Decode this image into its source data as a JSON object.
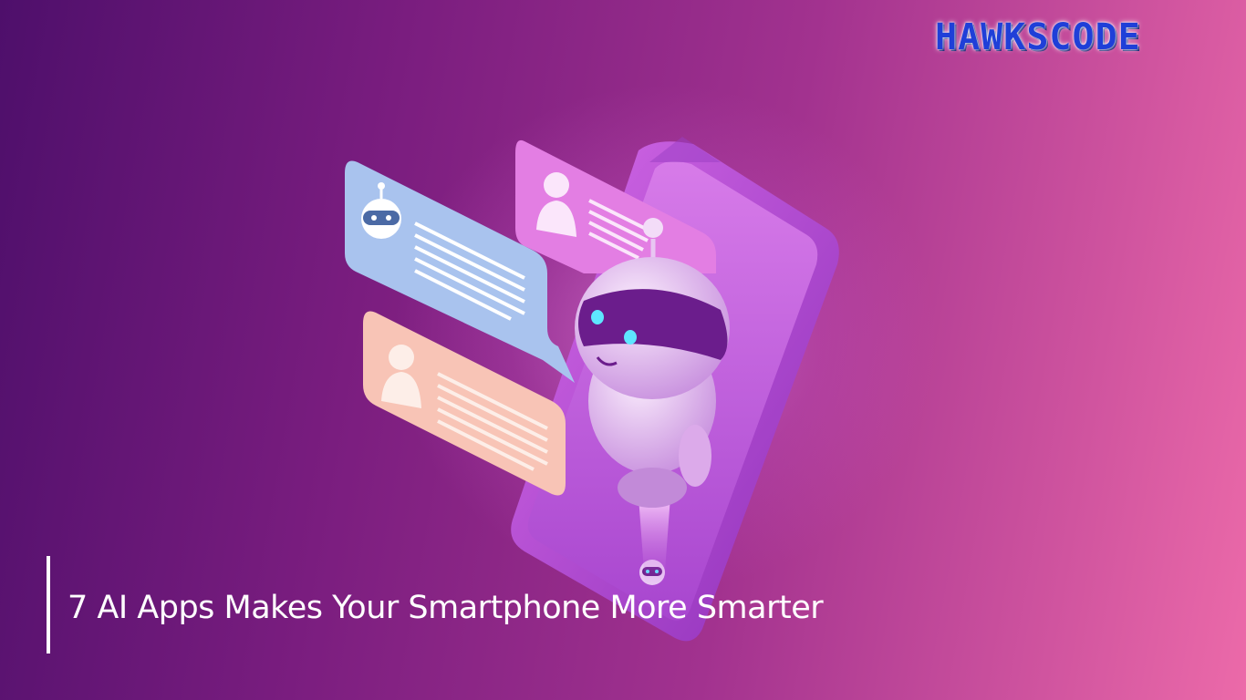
{
  "brand": {
    "logo_text": "HAWKSCODE",
    "color": "#1f3fd8"
  },
  "headline": {
    "text": "7 AI Apps Makes Your Smartphone More Smarter"
  },
  "illustration": {
    "subject": "robot-emerging-from-smartphone-with-chat-bubbles",
    "colors": {
      "background_left": "#4e0f6b",
      "background_right": "#ec6aa9",
      "phone": "#b545d6",
      "bubble_blue": "#a9c3ee",
      "bubble_pink": "#e37ee3",
      "bubble_peach": "#f8c4b6",
      "robot_body": "#e6c2f0",
      "robot_visor": "#6b1d8c",
      "robot_eyes": "#5ee6ff"
    }
  }
}
